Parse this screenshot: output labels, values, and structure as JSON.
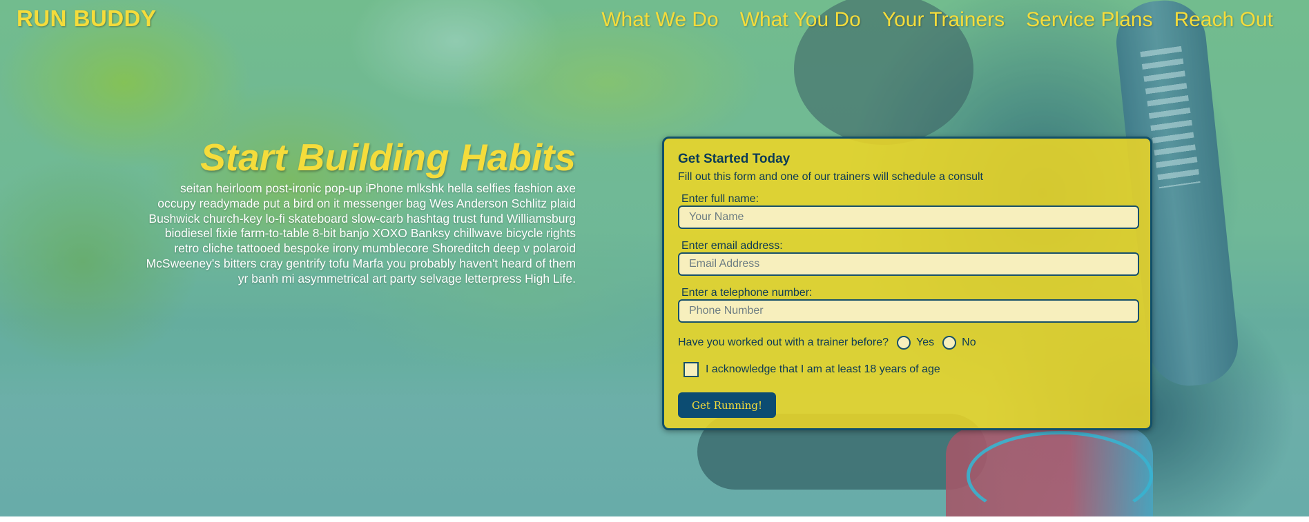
{
  "brand": "RUN BUDDY",
  "nav": {
    "items": [
      "What We Do",
      "What You Do",
      "Your Trainers",
      "Service Plans",
      "Reach Out"
    ]
  },
  "intro": {
    "heading": "Start Building Habits",
    "body": "seitan heirloom post-ironic pop-up iPhone mlkshk hella selfies fashion axe occupy readymade put a bird on it messenger bag Wes Anderson Schlitz plaid Bushwick church-key lo-fi skateboard slow-carb hashtag trust fund Williamsburg biodiesel fixie farm-to-table 8-bit banjo XOXO Banksy chillwave bicycle rights retro cliche tattooed bespoke irony mumblecore Shoreditch deep v polaroid McSweeney's bitters cray gentrify tofu Marfa you probably haven't heard of them yr banh mi asymmetrical art party selvage letterpress High Life."
  },
  "form": {
    "title": "Get Started Today",
    "lead": "Fill out this form and one of our trainers will schedule a consult",
    "name_label": "Enter full name:",
    "name_placeholder": "Your Name",
    "name_value": "",
    "email_label": "Enter email address:",
    "email_placeholder": "Email Address",
    "email_value": "",
    "phone_label": "Enter a telephone number:",
    "phone_placeholder": "Phone Number",
    "phone_value": "",
    "trainer_question": "Have you worked out with a trainer before?",
    "radio_yes": "Yes",
    "radio_no": "No",
    "acknowledge": "I acknowledge that I am at least 18 years of age",
    "submit_label": "Get Running!"
  },
  "colors": {
    "accent_yellow": "#f5dc3b",
    "form_bg": "#efd624",
    "navy": "#0c4c72",
    "text_dark": "#0d3a55"
  }
}
